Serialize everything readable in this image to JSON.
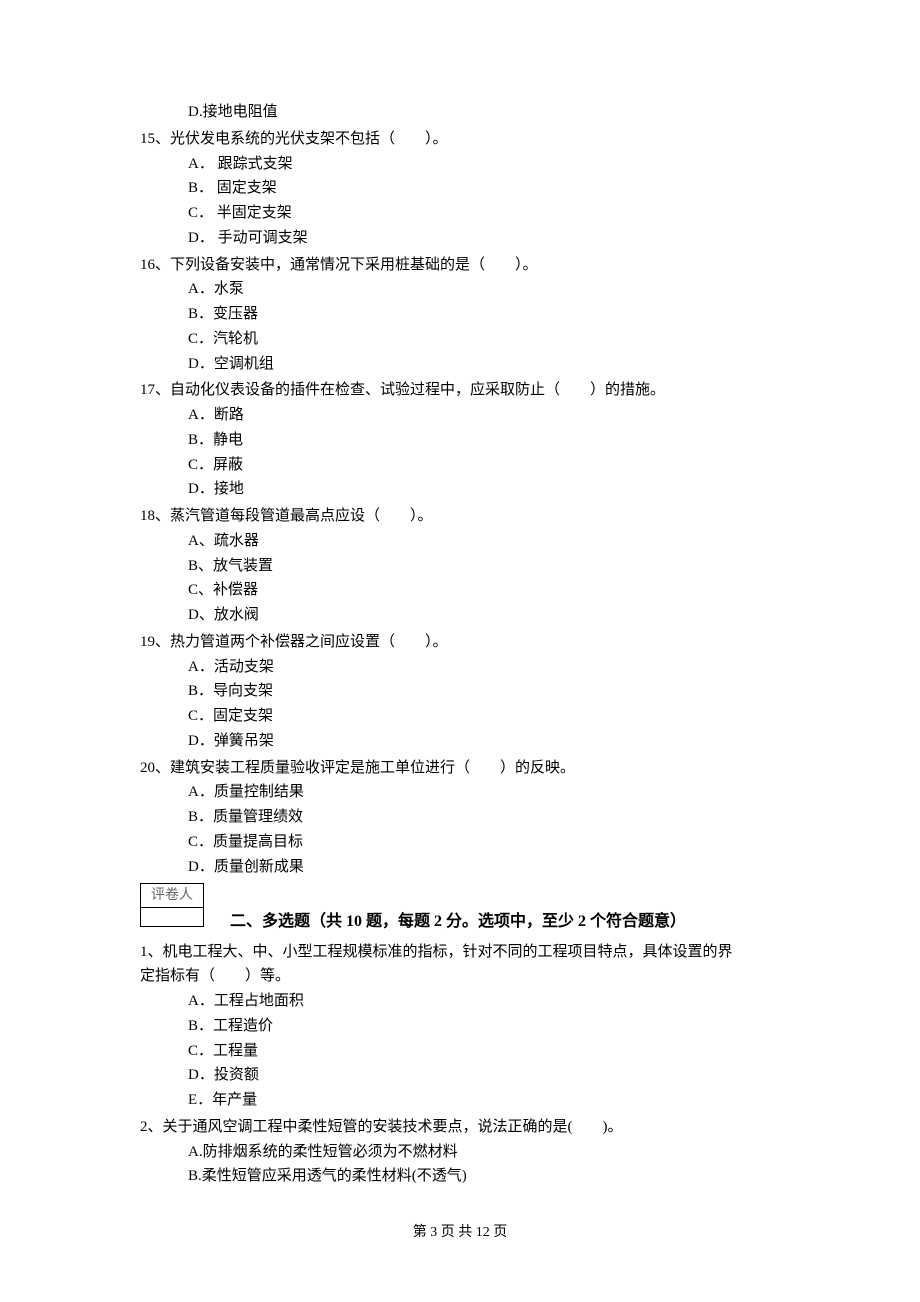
{
  "questions_part1": [
    {
      "number": "",
      "stem_lines": [],
      "options": [
        {
          "label": "D.接地电阻值"
        }
      ]
    },
    {
      "number": "15、",
      "stem_lines": [
        "光伏发电系统的光伏支架不包括（　　）。"
      ],
      "options": [
        {
          "label": "A． 跟踪式支架"
        },
        {
          "label": "B． 固定支架"
        },
        {
          "label": "C． 半固定支架"
        },
        {
          "label": "D． 手动可调支架"
        }
      ]
    },
    {
      "number": "16、",
      "stem_lines": [
        "下列设备安装中，通常情况下采用桩基础的是（　　）。"
      ],
      "options": [
        {
          "label": "A．水泵"
        },
        {
          "label": "B．变压器"
        },
        {
          "label": "C．汽轮机"
        },
        {
          "label": "D．空调机组"
        }
      ]
    },
    {
      "number": "17、",
      "stem_lines": [
        "自动化仪表设备的插件在检查、试验过程中，应采取防止（　　）的措施。"
      ],
      "options": [
        {
          "label": "A．断路"
        },
        {
          "label": "B．静电"
        },
        {
          "label": "C．屏蔽"
        },
        {
          "label": "D．接地"
        }
      ]
    },
    {
      "number": "18、",
      "stem_lines": [
        "蒸汽管道每段管道最高点应设（　　）。"
      ],
      "options": [
        {
          "label": "A、疏水器"
        },
        {
          "label": "B、放气装置"
        },
        {
          "label": "C、补偿器"
        },
        {
          "label": "D、放水阀"
        }
      ]
    },
    {
      "number": "19、",
      "stem_lines": [
        "热力管道两个补偿器之间应设置（　　）。"
      ],
      "options": [
        {
          "label": "A．活动支架"
        },
        {
          "label": "B．导向支架"
        },
        {
          "label": "C．固定支架"
        },
        {
          "label": "D．弹簧吊架"
        }
      ]
    },
    {
      "number": "20、",
      "stem_lines": [
        "建筑安装工程质量验收评定是施工单位进行（　　）的反映。"
      ],
      "options": [
        {
          "label": "A．质量控制结果"
        },
        {
          "label": "B．质量管理绩效"
        },
        {
          "label": "C．质量提高目标"
        },
        {
          "label": "D．质量创新成果"
        }
      ]
    }
  ],
  "grader_label": "评卷人",
  "section2_heading": "二、多选题（共 10 题，每题 2 分。选项中，至少 2 个符合题意）",
  "questions_part2": [
    {
      "number": "1、",
      "stem_lines": [
        "机电工程大、中、小型工程规模标准的指标，针对不同的工程项目特点，具体设置的界",
        "定指标有（　　）等。"
      ],
      "options": [
        {
          "label": "A．工程占地面积"
        },
        {
          "label": "B．工程造价"
        },
        {
          "label": "C．工程量"
        },
        {
          "label": "D．投资额"
        },
        {
          "label": "E．年产量"
        }
      ]
    },
    {
      "number": "2、",
      "stem_lines": [
        "关于通风空调工程中柔性短管的安装技术要点，说法正确的是(　　)。"
      ],
      "options": [
        {
          "label": "A.防排烟系统的柔性短管必须为不燃材料"
        },
        {
          "label": "B.柔性短管应采用透气的柔性材料(不透气)"
        }
      ]
    }
  ],
  "footer": "第 3 页 共 12 页"
}
